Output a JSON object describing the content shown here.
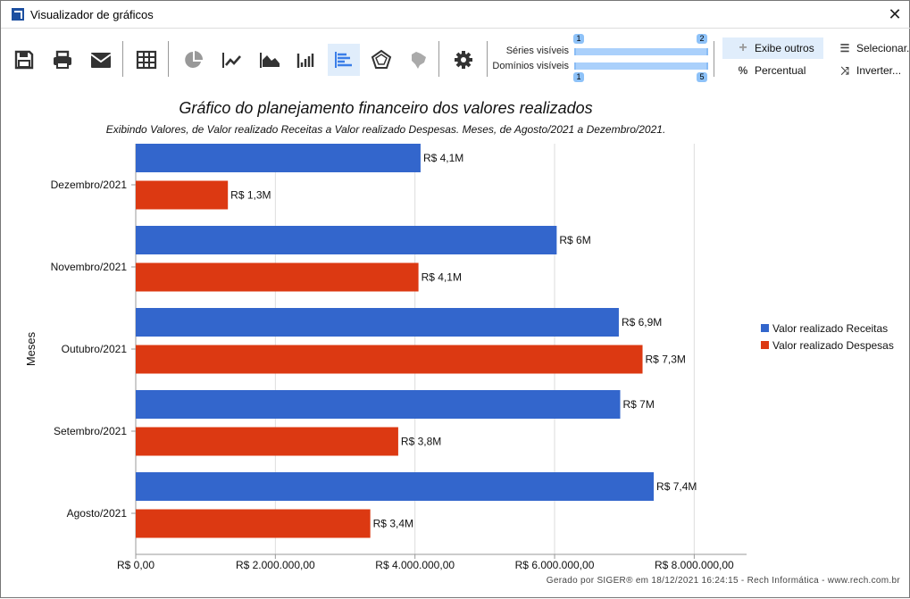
{
  "window": {
    "title": "Visualizador de gráficos",
    "close_icon": "close-icon"
  },
  "toolbar": {
    "icons": [
      "save-icon",
      "print-icon",
      "email-icon",
      "table-icon",
      "pie-chart-icon",
      "line-chart-icon",
      "area-chart-icon",
      "column-chart-icon",
      "bar-chart-icon",
      "radar-chart-icon",
      "brazil-map-icon",
      "gear-icon"
    ],
    "active": "bar-chart-icon",
    "series_label": "Séries visíveis",
    "series_min": "1",
    "series_max": "2",
    "domains_label": "Domínios visíveis",
    "domains_min": "1",
    "domains_max": "5",
    "exibe_outros": "Exibe outros",
    "percentual": "Percentual",
    "selecionar": "Selecionar...",
    "inverter": "Inverter..."
  },
  "chart_data": {
    "type": "bar",
    "orientation": "horizontal",
    "title": "Gráfico do planejamento financeiro dos valores realizados",
    "subtitle": "Exibindo Valores, de Valor realizado Receitas a Valor realizado Despesas. Meses, de Agosto/2021 a Dezembro/2021.",
    "ylabel": "Meses",
    "xlabel": "",
    "categories": [
      "Dezembro/2021",
      "Novembro/2021",
      "Outubro/2021",
      "Setembro/2021",
      "Agosto/2021"
    ],
    "series": [
      {
        "name": "Valor realizado Receitas",
        "color": "#3366cc",
        "values": [
          4080000,
          6030000,
          6920000,
          6940000,
          7420000
        ],
        "labels": [
          "R$ 4,1M",
          "R$ 6M",
          "R$ 6,9M",
          "R$ 7M",
          "R$ 7,4M"
        ]
      },
      {
        "name": "Valor realizado Despesas",
        "color": "#dc3912",
        "values": [
          1320000,
          4050000,
          7260000,
          3760000,
          3360000
        ],
        "labels": [
          "R$ 1,3M",
          "R$ 4,1M",
          "R$ 7,3M",
          "R$ 3,8M",
          "R$ 3,4M"
        ]
      }
    ],
    "xlim": [
      0,
      8750000
    ],
    "xticks": [
      0,
      2000000,
      4000000,
      6000000,
      8000000
    ],
    "xtick_labels": [
      "R$ 0,00",
      "R$ 2.000.000,00",
      "R$ 4.000.000,00",
      "R$ 6.000.000,00",
      "R$ 8.000.000,00"
    ],
    "grid": true,
    "legend": "right"
  },
  "footer": "Gerado por SIGER® em 18/12/2021 16:24:15 - Rech Informática - www.rech.com.br"
}
